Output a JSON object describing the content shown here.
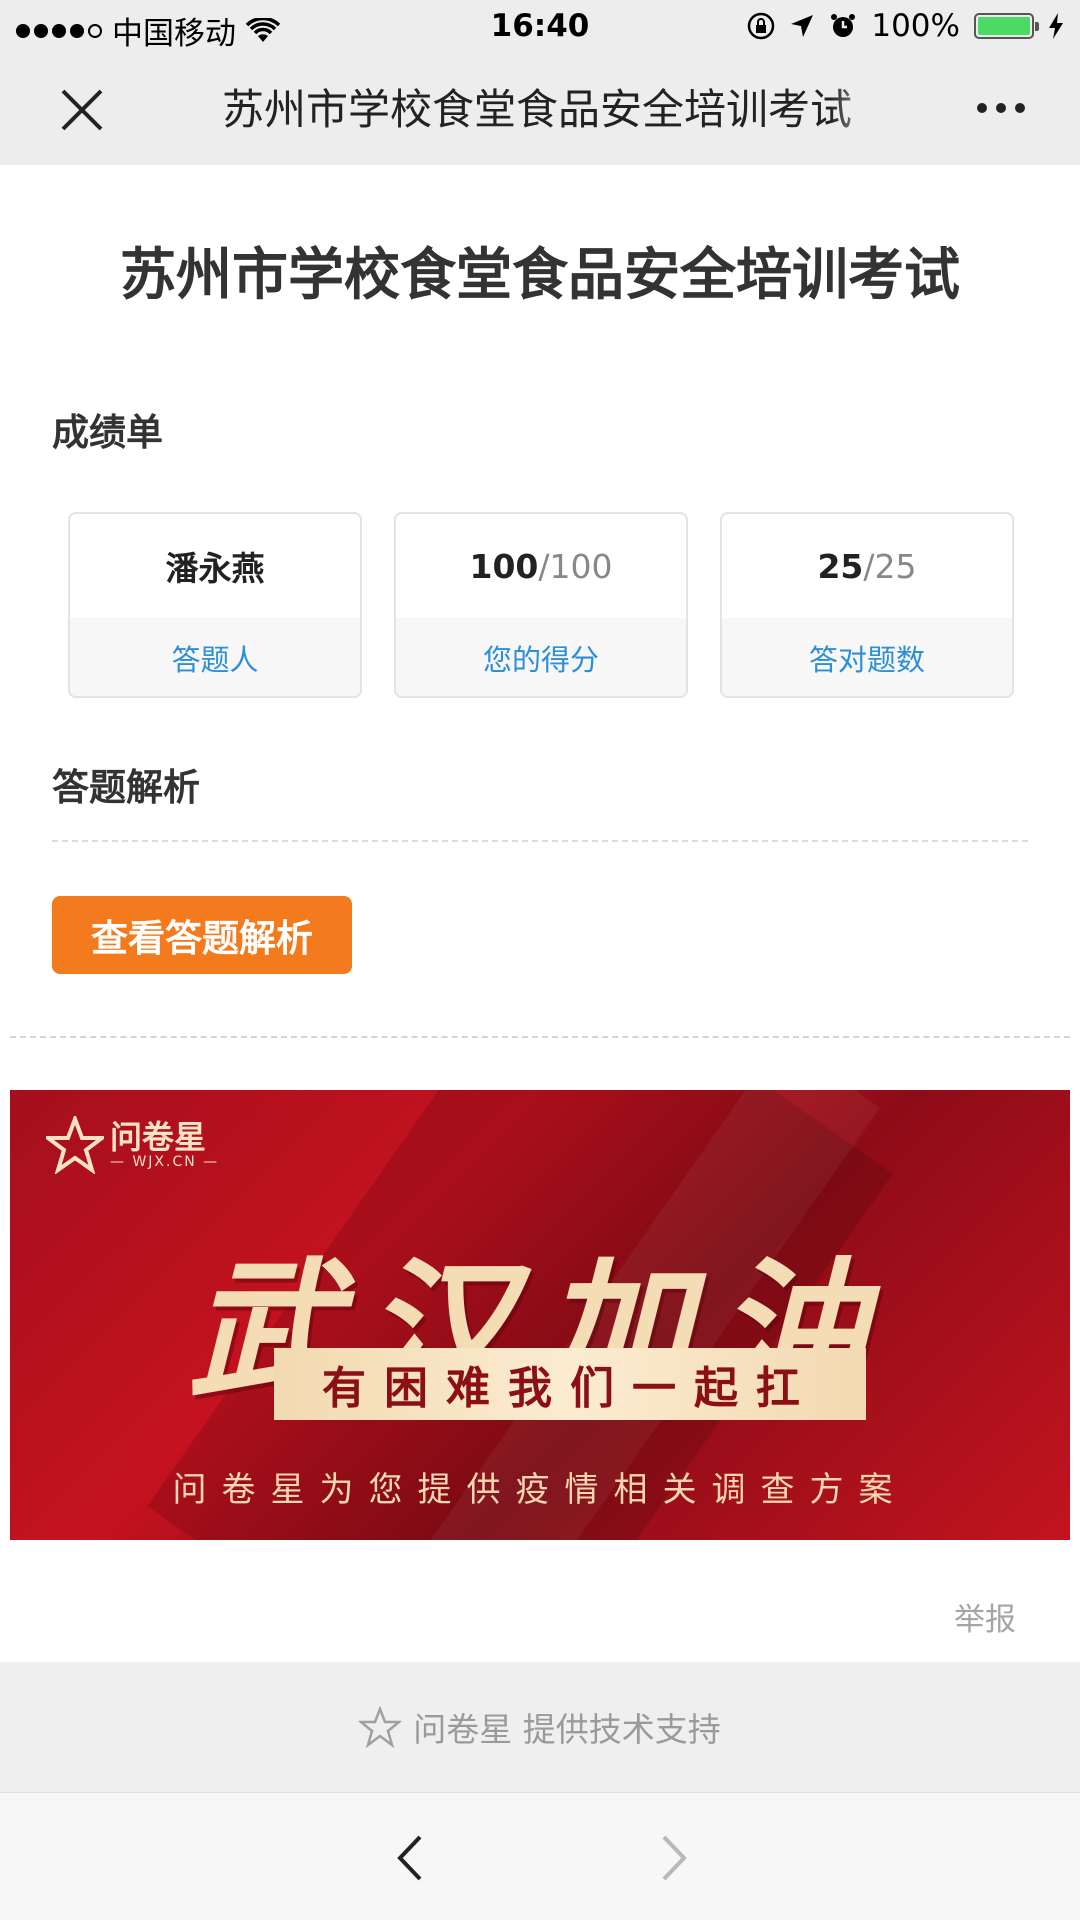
{
  "status_bar": {
    "carrier": "中国移动",
    "time": "16:40",
    "battery": "100%"
  },
  "nav": {
    "title": "苏州市学校食堂食品安全培训考试"
  },
  "page": {
    "title": "苏州市学校食堂食品安全培训考试"
  },
  "scorecard": {
    "heading": "成绩单",
    "respondent_value": "潘永燕",
    "respondent_label": "答题人",
    "score_value": "100",
    "score_total": "/100",
    "score_label": "您的得分",
    "correct_value": "25",
    "correct_total": "/25",
    "correct_label": "答对题数"
  },
  "analysis": {
    "heading": "答题解析",
    "button_label": "查看答题解析"
  },
  "banner": {
    "logo_text": "问卷星",
    "logo_sub": "— WJX.CN —",
    "main_text": "武汉加油",
    "pill_text": "有困难我们一起扛",
    "sub_text": "问卷星为您提供疫情相关调查方案"
  },
  "report_link": "举报",
  "footer": {
    "text": "问卷星 提供技术支持"
  },
  "colors": {
    "accent_orange": "#f37b1d",
    "link_blue": "#2d8fd5",
    "banner_red": "#c4121f",
    "battery_green": "#4cd964"
  }
}
